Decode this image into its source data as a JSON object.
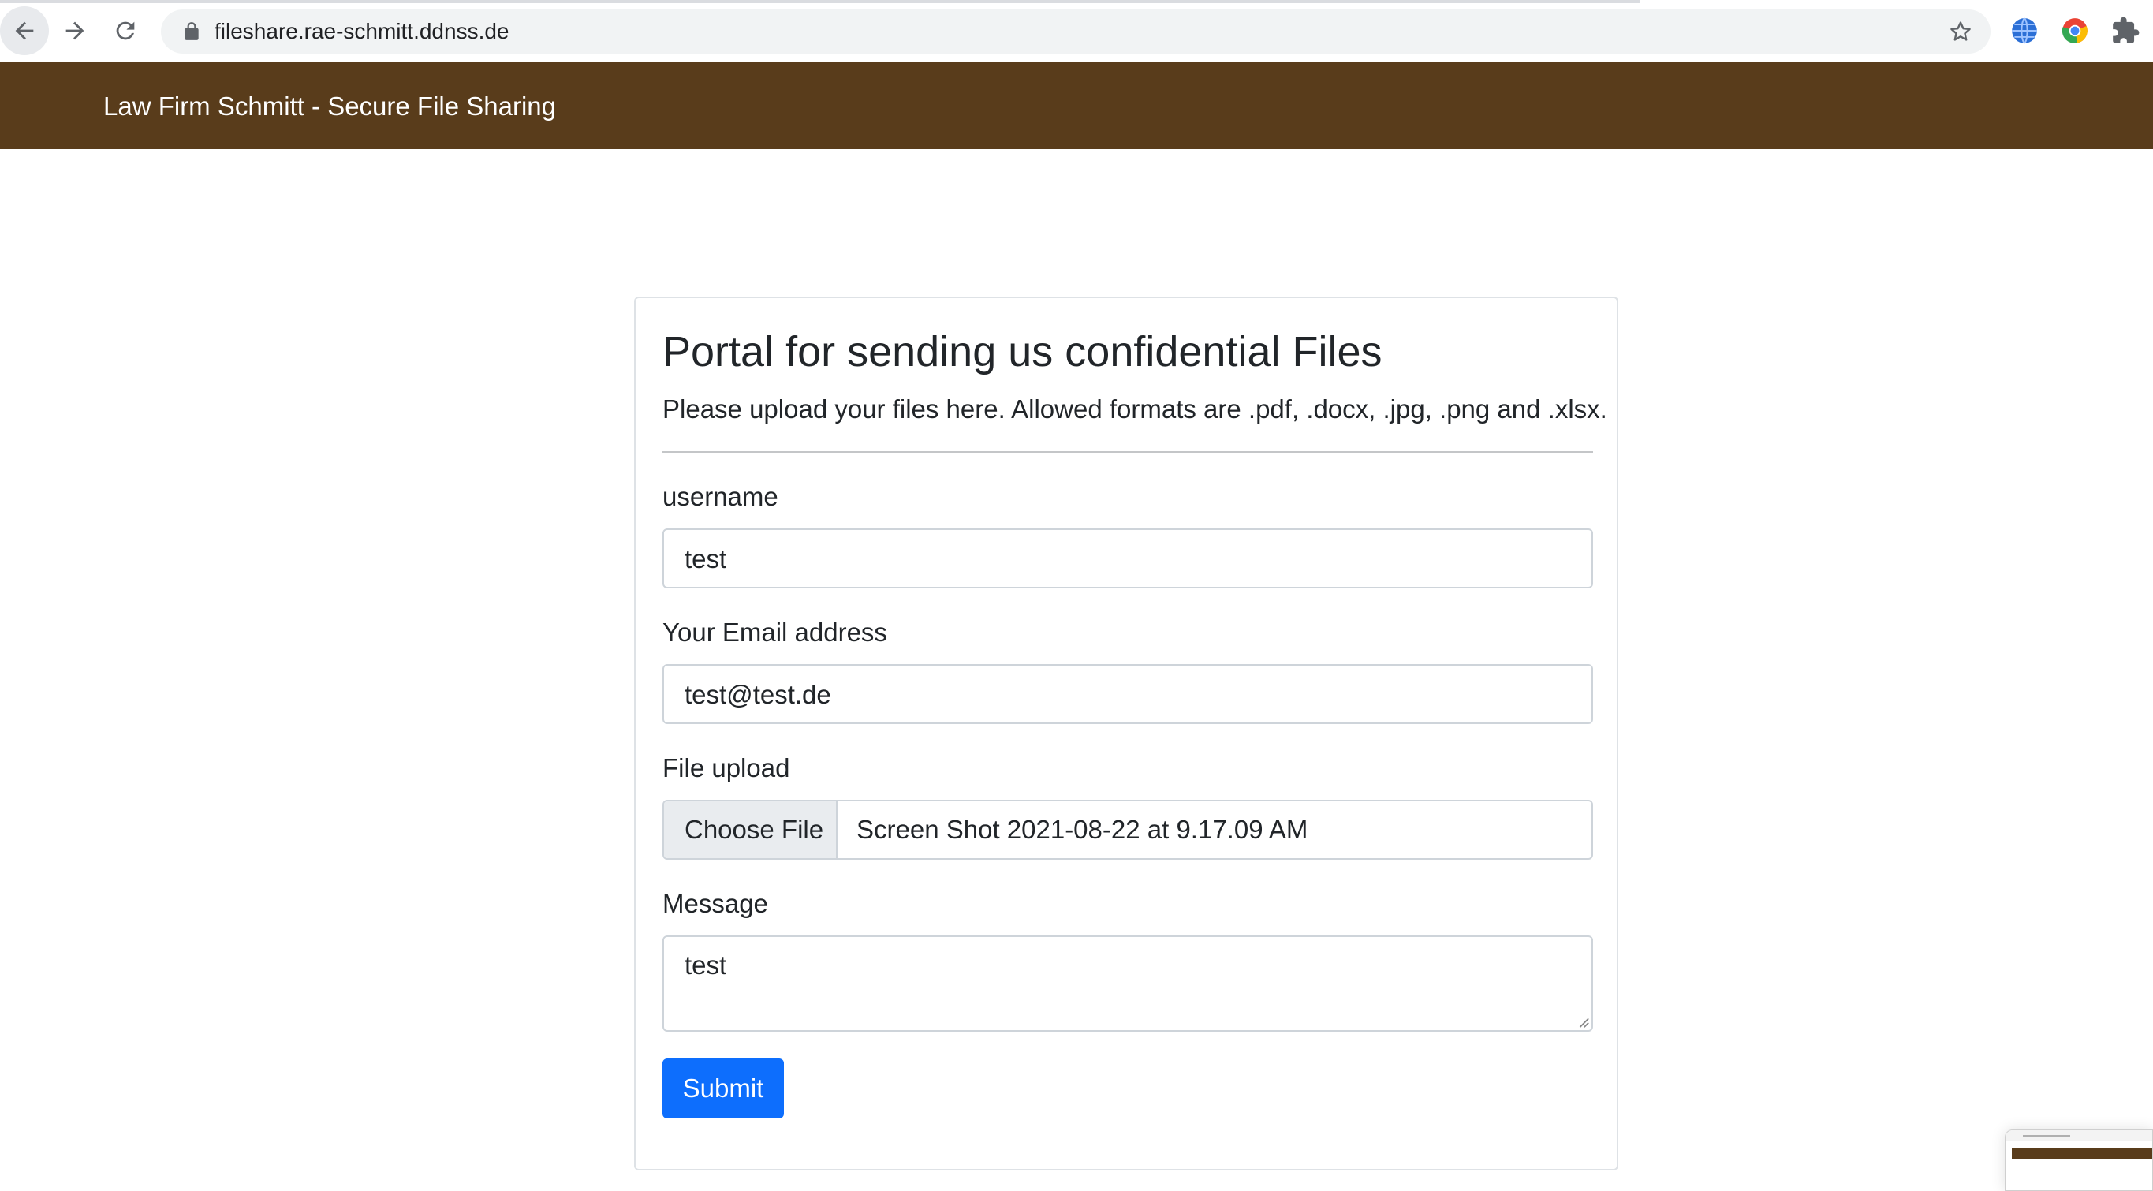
{
  "browser": {
    "url": "fileshare.rae-schmitt.ddnss.de",
    "icons": [
      "back-arrow-icon",
      "forward-arrow-icon",
      "reload-icon",
      "lock-icon",
      "star-icon",
      "globe-extension-icon",
      "chrome-extension-icon",
      "puzzle-extension-icon"
    ]
  },
  "navbar": {
    "brand": "Law Firm Schmitt - Secure File Sharing",
    "color": "#593c1b"
  },
  "card": {
    "title": "Portal for sending us confidential Files",
    "lead": "Please upload your files here. Allowed formats are .pdf, .docx, .jpg, .png and .xlsx.",
    "username": {
      "label": "username",
      "value": "test"
    },
    "email": {
      "label": "Your Email address",
      "value": "test@test.de"
    },
    "file": {
      "label": "File upload",
      "button": "Choose File",
      "filename": "Screen Shot 2021-08-22 at 9.17.09 AM"
    },
    "message": {
      "label": "Message",
      "value": "test"
    },
    "submit": {
      "label": "Submit",
      "color": "#0d6efd"
    }
  }
}
